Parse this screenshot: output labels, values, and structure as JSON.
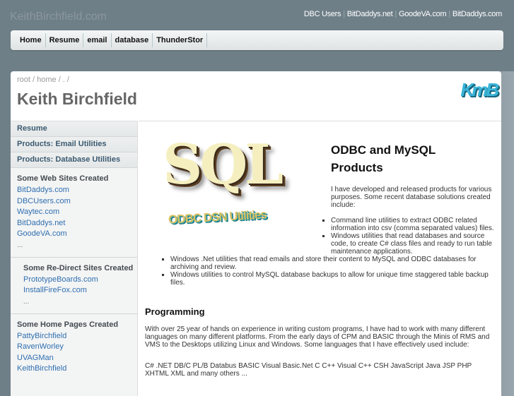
{
  "site_title": "KeithBirchfield.com",
  "top_links": [
    "DBC Users",
    "BitDaddys.net",
    "GoodeVA.com",
    "BitDaddys.com"
  ],
  "nav": [
    "Home",
    "Resume",
    "email",
    "database",
    "ThunderStor"
  ],
  "breadcrumb": "root / home / . /",
  "page_title": "Keith Birchfield",
  "logo_text": "KmB",
  "sidebar": {
    "items": [
      "Resume",
      "Products: Email Utilities",
      "Products: Database Utilities"
    ],
    "web_sites": {
      "heading": "Some Web Sites Created",
      "links": [
        "BitDaddys.com",
        "DBCUsers.com",
        "Waytec.com",
        "BitDaddys.net",
        "GoodeVA.com"
      ],
      "more": "..."
    },
    "redirects": {
      "heading": "Some Re-Direct Sites Created",
      "links": [
        "PrototypeBoards.com",
        "InstallFireFox.com"
      ],
      "more": "..."
    },
    "home_pages": {
      "heading": "Some Home Pages Created",
      "links": [
        "PattyBirchfield",
        "RavenWorley",
        "UVAGMan",
        "KeithBirchfield"
      ]
    }
  },
  "content": {
    "image_text": {
      "big": "SQL",
      "sub": "ODBC DSN Utilities"
    },
    "heading": "ODBC and MySQL Products",
    "intro": "I have developed and released products for various purposes. Some recent database solutions created include:",
    "bullets": [
      "Command line utilities to extract ODBC related information into csv (comma separated values) files.",
      "Windows utilities that read databases and source code, to create C# class files and ready to run table maintenance applications.",
      "Windows .Net utilities that read emails and store their content to MySQL and ODBC databases for archiving and review.",
      "Windows utilities to control MySQL database backups to allow for unique time staggered table backup files."
    ],
    "prog_heading": "Programming",
    "prog_text": "With over 25 year of hands on experience in writing custom programs, I have had to work with many different languages on many different platforms. From the early days of CPM and BASIC through the Minis of RMS and VMS to the Desktops utilizing Linux and Windows. Some languages that I have effectively used include:",
    "languages": "C# .NET DB/C PL/B Databus BASIC Visual Basic.Net C C++ Visual C++ CSH JavaScript Java JSP PHP XHTML XML and many others ..."
  }
}
